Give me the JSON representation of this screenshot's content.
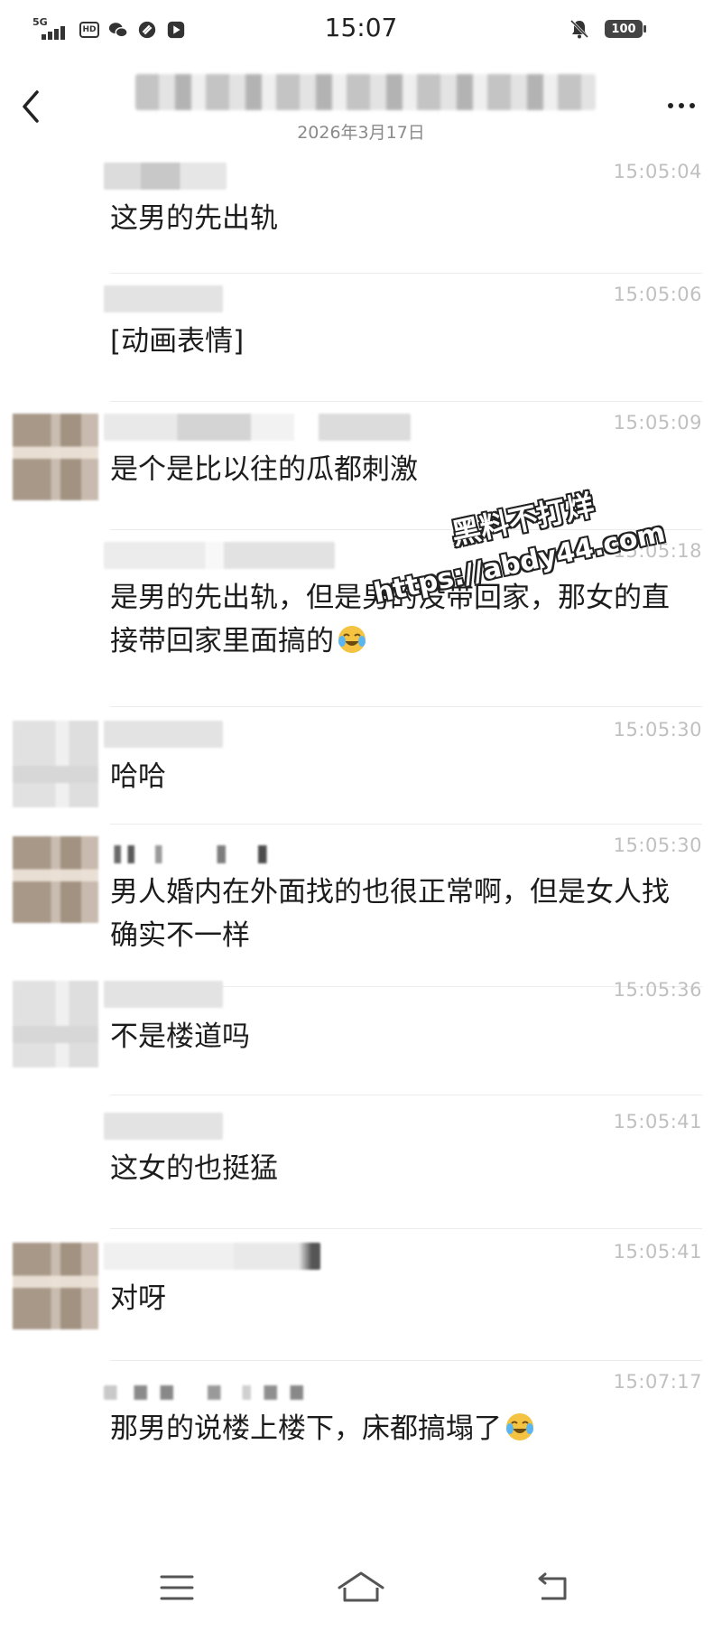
{
  "status_bar": {
    "time": "15:07",
    "network": "5G",
    "hd_label": "HD",
    "battery": "100",
    "icons": [
      "signal-icon",
      "hd-icon",
      "wechat-icon",
      "link-icon",
      "play-icon",
      "mute-icon",
      "battery-icon"
    ]
  },
  "header": {
    "date": "2026年3月17日",
    "icons": [
      "back-icon",
      "more-icon"
    ]
  },
  "messages": [
    {
      "time": "15:05:04",
      "text": "这男的先出轨"
    },
    {
      "time": "15:05:06",
      "text": "[动画表情]"
    },
    {
      "time": "15:05:09",
      "text": "是个是比以往的瓜都刺激"
    },
    {
      "time": "15:05:18",
      "text": "是男的先出轨，但是男的没带回家，那女的直接带回家里面搞的"
    },
    {
      "time": "15:05:30",
      "text": "哈哈"
    },
    {
      "time": "15:05:30",
      "text": "男人婚内在外面找的也很正常啊，但是女人找确实不一样"
    },
    {
      "time": "15:05:36",
      "text": "不是楼道吗"
    },
    {
      "time": "15:05:41",
      "text": "这女的也挺猛"
    },
    {
      "time": "15:05:41",
      "text": "对呀"
    },
    {
      "time": "15:07:17",
      "text": "那男的说楼上楼下，床都搞塌了"
    }
  ],
  "watermark": {
    "line1": "黑料不打烊",
    "line2": "https://abdy44.com"
  },
  "nav": {
    "icons": [
      "menu-icon",
      "home-icon",
      "back-nav-icon"
    ]
  },
  "colors": {
    "time_gray": "#c0c0c0",
    "text": "#1c1c1c",
    "separator": "#ececec"
  }
}
